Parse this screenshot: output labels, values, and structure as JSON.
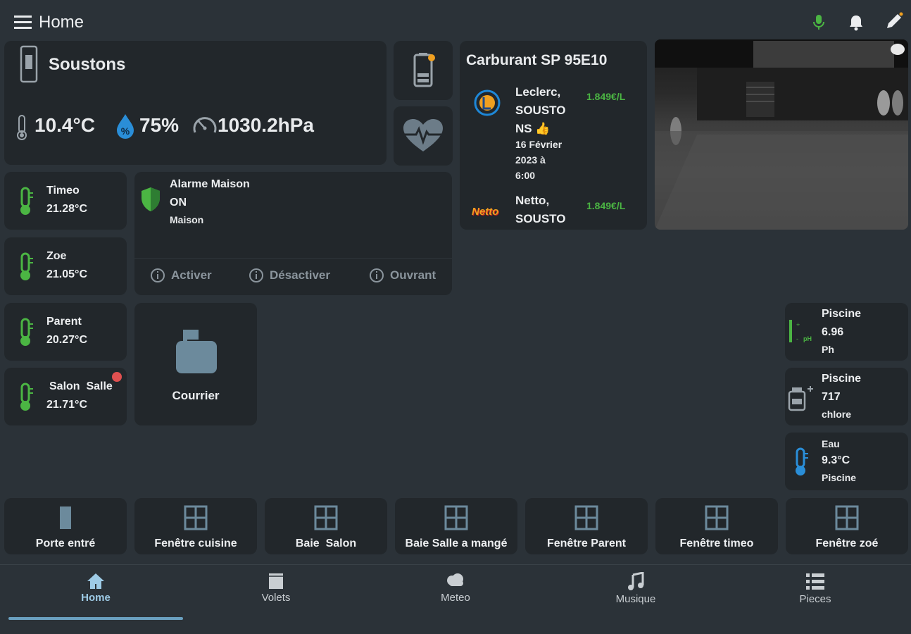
{
  "header": {
    "title": "Home",
    "icons": [
      "menu-icon",
      "microphone-icon",
      "bell-icon",
      "pencil-icon"
    ]
  },
  "weather": {
    "location": "Soustons",
    "temperature": "10.4°C",
    "humidity": "75%",
    "pressure": "1030.2hPa"
  },
  "fuel": {
    "title": "Carburant SP 95E10",
    "stations": [
      {
        "name_l1": "Leclerc,",
        "name_l2": "SOUSTO",
        "name_l3": "NS 👍",
        "date_l1": "16 Février",
        "date_l2": "2023 à",
        "date_l3": "6:00",
        "price": "1.849€/L"
      },
      {
        "brand": "Netto",
        "name_l1": "Netto,",
        "name_l2": "SOUSTO",
        "price": "1.849€/L"
      }
    ]
  },
  "rooms": [
    {
      "name": "Timeo",
      "temp": "21.28°C"
    },
    {
      "name": "Zoe",
      "temp": "21.05°C"
    },
    {
      "name": "Parent",
      "temp": "20.27°C"
    },
    {
      "name": "Salon  Salle",
      "temp": "21.71°C"
    }
  ],
  "alarm": {
    "title": "Alarme Maison",
    "state": "ON",
    "zone": "Maison",
    "actions": [
      "Activer",
      "Désactiver",
      "Ouvrant"
    ]
  },
  "mail": {
    "label": "Courrier"
  },
  "pool": [
    {
      "title": "Piscine",
      "value": "6.96",
      "unit": "Ph"
    },
    {
      "title": "Piscine",
      "value": "717",
      "unit": "chlore"
    },
    {
      "title": "Eau",
      "value": "9.3°C",
      "unit": "Piscine"
    }
  ],
  "openings": [
    "Porte entré",
    "Fenêtre cuisine",
    "Baie  Salon",
    "Baie Salle a mangé",
    "Fenêtre Parent",
    "Fenêtre timeo",
    "Fenêtre zoé"
  ],
  "nav": {
    "items": [
      "Home",
      "Volets",
      "Meteo",
      "Musique",
      "Pieces"
    ],
    "active": "Home"
  },
  "colors": {
    "background": "#2b3238",
    "card": "#22272b",
    "accent": "#9ecbe6",
    "green": "#4bb543",
    "alert": "#e05050",
    "orange": "#f0a020"
  }
}
